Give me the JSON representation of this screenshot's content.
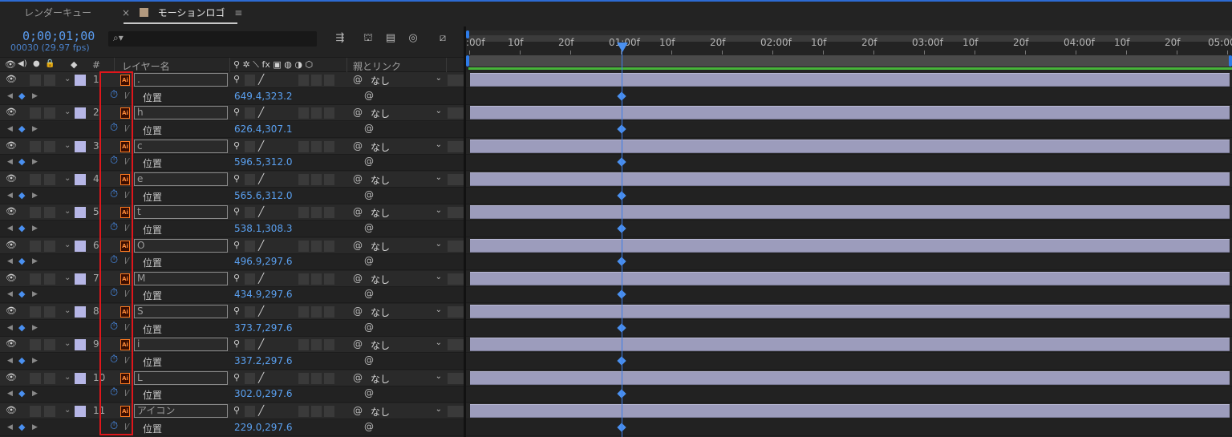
{
  "tabs": {
    "render_queue": "レンダーキュー",
    "active_close": "×",
    "active_label": "モーションロゴ",
    "active_menu": "≡"
  },
  "header": {
    "timecode": "0;00;01;00",
    "fps": "00030 (29.97 fps)",
    "search_placeholder": ""
  },
  "columns": {
    "hash": "#",
    "layer_name": "レイヤー名",
    "parent_link": "親とリンク"
  },
  "ruler": {
    "labels": [
      ":00f",
      "10f",
      "20f",
      "01:00f",
      "10f",
      "20f",
      "02:00f",
      "10f",
      "20f",
      "03:00f",
      "10f",
      "20f",
      "04:00f",
      "10f",
      "20f",
      "05:00"
    ]
  },
  "layers": [
    {
      "num": "1",
      "name": ".",
      "parent": "なし",
      "prop": "位置",
      "value": "649.4,323.2"
    },
    {
      "num": "2",
      "name": "h",
      "parent": "なし",
      "prop": "位置",
      "value": "626.4,307.1"
    },
    {
      "num": "3",
      "name": "c",
      "parent": "なし",
      "prop": "位置",
      "value": "596.5,312.0"
    },
    {
      "num": "4",
      "name": "e",
      "parent": "なし",
      "prop": "位置",
      "value": "565.6,312.0"
    },
    {
      "num": "5",
      "name": "t",
      "parent": "なし",
      "prop": "位置",
      "value": "538.1,308.3"
    },
    {
      "num": "6",
      "name": "O",
      "parent": "なし",
      "prop": "位置",
      "value": "496.9,297.6"
    },
    {
      "num": "7",
      "name": "M",
      "parent": "なし",
      "prop": "位置",
      "value": "434.9,297.6"
    },
    {
      "num": "8",
      "name": "S",
      "parent": "なし",
      "prop": "位置",
      "value": "373.7,297.6"
    },
    {
      "num": "9",
      "name": "i",
      "parent": "なし",
      "prop": "位置",
      "value": "337.2,297.6"
    },
    {
      "num": "10",
      "name": "L",
      "parent": "なし",
      "prop": "位置",
      "value": "302.0,297.6"
    },
    {
      "num": "11",
      "name": "アイコン",
      "parent": "なし",
      "prop": "位置",
      "value": "229.0,297.6"
    }
  ],
  "colors": {
    "accent": "#4a90f0",
    "layer_bar": "#9c9cbc",
    "label": "#b6b6e6",
    "highlight": "#e0161b",
    "work_area": "#47b43a"
  }
}
